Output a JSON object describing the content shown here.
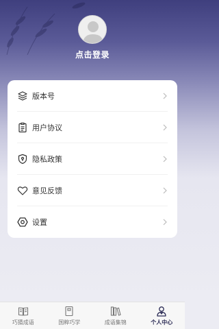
{
  "profile": {
    "login_label": "点击登录"
  },
  "menu": [
    {
      "label": "版本号",
      "icon": "layers-icon"
    },
    {
      "label": "用户协议",
      "icon": "clipboard-icon"
    },
    {
      "label": "隐私政策",
      "icon": "shield-icon"
    },
    {
      "label": "意见反馈",
      "icon": "heart-icon"
    },
    {
      "label": "设置",
      "icon": "hexagon-settings-icon"
    }
  ],
  "tabbar": {
    "tabs": [
      {
        "label": "巧猜成语",
        "icon": "book-icon",
        "active": false
      },
      {
        "label": "国粹巧学",
        "icon": "notebook-icon",
        "active": false
      },
      {
        "label": "成语集锦",
        "icon": "books-icon",
        "active": false
      },
      {
        "label": "个人中心",
        "icon": "person-icon",
        "active": true
      }
    ]
  },
  "colors": {
    "header_top": "#3f3f7e",
    "background": "#ececf3",
    "active_tab": "#2b2b55"
  }
}
